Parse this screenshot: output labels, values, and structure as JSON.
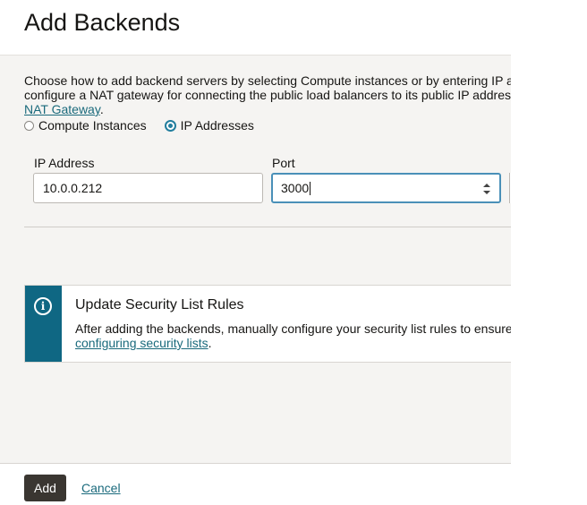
{
  "panel": {
    "title": "Add Backends"
  },
  "intro": {
    "line1": "Choose how to add backend servers by selecting Compute instances or by entering IP a",
    "line2": "configure a NAT gateway for connecting the public load balancers to its public IP addres",
    "link": "NAT Gateway",
    "link_suffix": "."
  },
  "source_options": [
    {
      "label": "Compute Instances",
      "selected": false
    },
    {
      "label": "IP Addresses",
      "selected": true
    }
  ],
  "fields": {
    "ip_address": {
      "label": "IP Address",
      "value": "10.0.0.212"
    },
    "port": {
      "label": "Port",
      "value": "3000"
    }
  },
  "info": {
    "icon": "info-icon",
    "title": "Update Security List Rules",
    "text": "After adding the backends, manually configure your security list rules to ensure",
    "link": "configuring security lists",
    "link_suffix": "."
  },
  "footer": {
    "add_label": "Add",
    "cancel_label": "Cancel"
  },
  "colors": {
    "accent": "#0f6783",
    "link": "#1a6a7c",
    "primary_button": "#3a3631",
    "body_bg": "#f5f4f2"
  }
}
